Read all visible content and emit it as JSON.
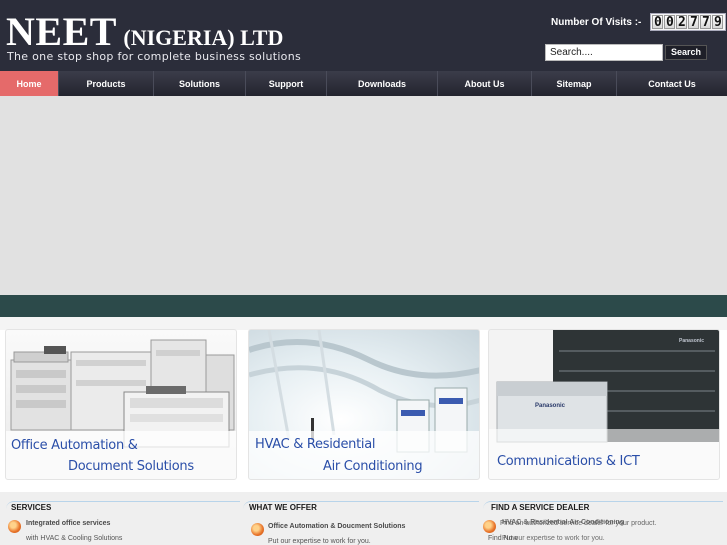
{
  "header": {
    "logo_main": "NEET",
    "logo_sub": "(NIGERIA) LTD",
    "tagline": "The one stop shop for complete business solutions",
    "visits_label": "Number Of Visits :-",
    "visit_digits": [
      "0",
      "0",
      "2",
      "7",
      "7",
      "9"
    ],
    "search_placeholder": "Search....",
    "search_button": "Search"
  },
  "nav": [
    {
      "label": "Home",
      "active": true
    },
    {
      "label": "Products",
      "active": false
    },
    {
      "label": "Solutions",
      "active": false
    },
    {
      "label": "Support",
      "active": false
    },
    {
      "label": "Downloads",
      "active": false
    },
    {
      "label": "About Us",
      "active": false
    },
    {
      "label": "Sitemap",
      "active": false
    },
    {
      "label": "Contact Us",
      "active": false
    }
  ],
  "cards": [
    {
      "line1": "Office Automation &",
      "line2": "Document Solutions"
    },
    {
      "line1": "HVAC & Residential",
      "line2": "Air Conditioning"
    },
    {
      "line1": "Communications & ICT",
      "device_label": "Panasonic"
    }
  ],
  "columns": {
    "services": {
      "heading": "SERVICES",
      "title": "Integrated office services",
      "sub": "with HVAC & Cooling Solutions"
    },
    "offer": {
      "heading": "WHAT WE OFFER",
      "title": "Office Automation & Doucment Solutions",
      "sub": "Put our expertise to work for you."
    },
    "dealer": {
      "heading": "FIND A SERVICE DEALER",
      "title_a": "HVAC & Residential Air Conditioning",
      "title_b": "Find an authorized service dealer for your product.",
      "sub_a": "Find Now",
      "sub_b": "Put our expertise to work for you."
    }
  },
  "colors": {
    "header_bg": "#2b2d3a",
    "nav_active": "#e56a6a",
    "teal_bar": "#2c4a4a",
    "caption_blue": "#2a4ea8",
    "bullet_orange": "#e8742a"
  }
}
